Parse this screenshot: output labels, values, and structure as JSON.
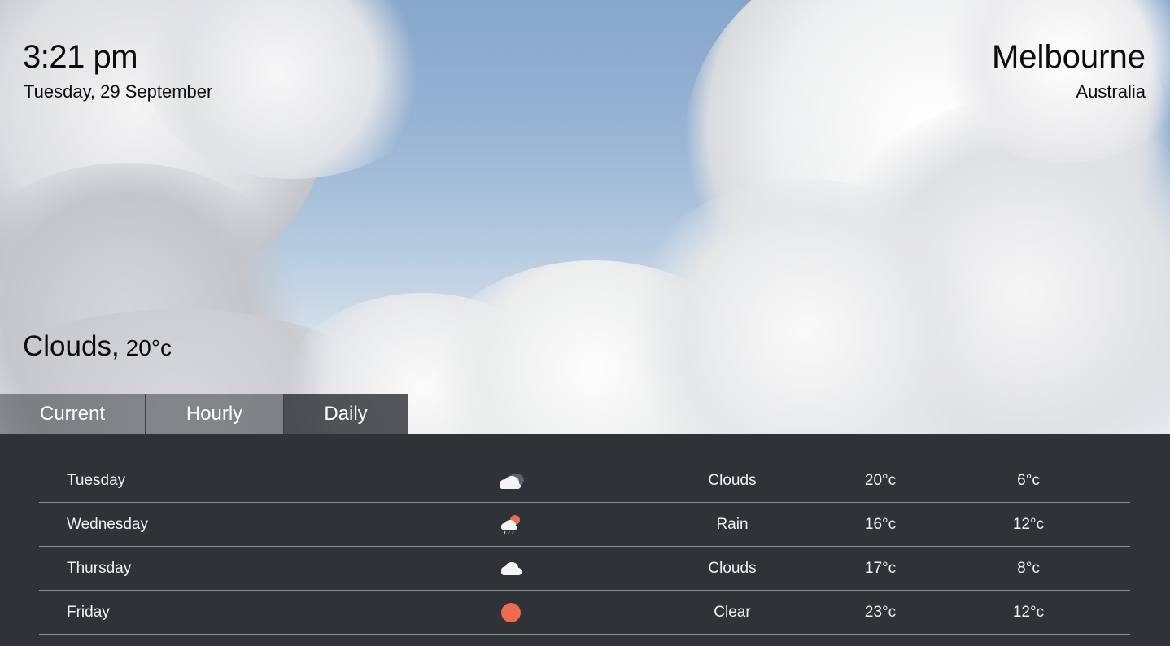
{
  "header": {
    "time": "3:21 pm",
    "date": "Tuesday, 29 September",
    "city": "Melbourne",
    "country": "Australia"
  },
  "current": {
    "condition": "Clouds,",
    "temperature": "20°c"
  },
  "tabs": [
    {
      "label": "Current",
      "active": false
    },
    {
      "label": "Hourly",
      "active": false
    },
    {
      "label": "Daily",
      "active": true
    }
  ],
  "daily": [
    {
      "day": "Tuesday",
      "icon": "cloud-icon",
      "condition": "Clouds",
      "high": "20°c",
      "low": "6°c"
    },
    {
      "day": "Wednesday",
      "icon": "rain-icon",
      "condition": "Rain",
      "high": "16°c",
      "low": "12°c"
    },
    {
      "day": "Thursday",
      "icon": "cloud-icon",
      "condition": "Clouds",
      "high": "17°c",
      "low": "8°c"
    },
    {
      "day": "Friday",
      "icon": "sun-icon",
      "condition": "Clear",
      "high": "23°c",
      "low": "12°c"
    }
  ],
  "colors": {
    "panel_background": "#2d3336",
    "sun": "#ee6c4d",
    "text_light": "#f2f2f2"
  }
}
